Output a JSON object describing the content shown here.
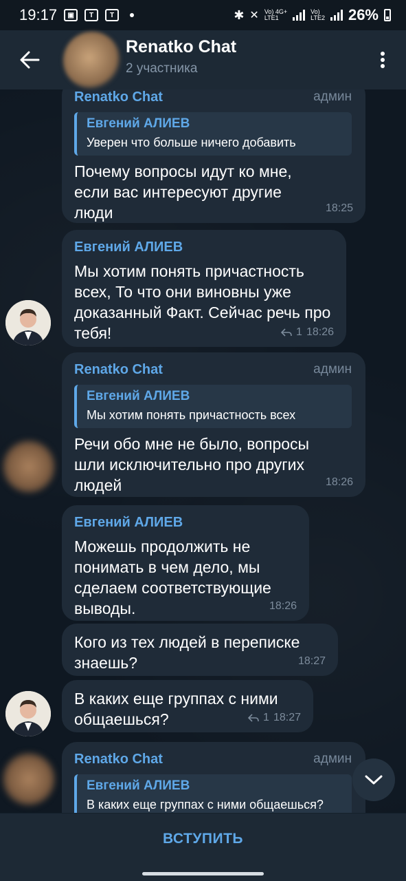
{
  "status_bar": {
    "time": "19:17",
    "network_1": "Vo) 4G+\nLTE1",
    "network_2": "Vo)\nLTE2",
    "battery": "26%"
  },
  "header": {
    "title": "Renatko Chat",
    "subtitle": "2 участника"
  },
  "messages": [
    {
      "sender": "Renatko Chat",
      "role": "админ",
      "reply_name": "Евгений АЛИЕВ",
      "reply_text": "Уверен что больше ничего добавить",
      "text": "Почему вопросы идут ко мне, если вас интересуют другие люди",
      "time": "18:25"
    },
    {
      "sender": "Евгений АЛИЕВ",
      "text": "Мы хотим понять причастность всех, То что они виновны уже доказанный Факт. Сейчас речь про тебя!",
      "replies": "1",
      "time": "18:26"
    },
    {
      "sender": "Renatko Chat",
      "role": "админ",
      "reply_name": "Евгений АЛИЕВ",
      "reply_text": "Мы хотим понять причастность всех",
      "text": "Речи обо мне не было, вопросы шли исключительно про других людей",
      "time": "18:26"
    },
    {
      "sender": "Евгений АЛИЕВ",
      "text": "Можешь продолжить не понимать в чем дело, мы сделаем соответствующие выводы.",
      "time": "18:26"
    },
    {
      "text": "Кого из тех людей в переписке знаешь?",
      "time": "18:27"
    },
    {
      "text": "В каких еще группах с ними общаешься?",
      "replies": "1",
      "time": "18:27"
    },
    {
      "sender": "Renatko Chat",
      "role": "админ",
      "reply_name": "Евгений АЛИЕВ",
      "reply_text": "В каких еще группах с ними общаешься?"
    }
  ],
  "join_button": "ВСТУПИТЬ",
  "icons": {
    "back": "arrow-left-icon",
    "menu": "more-vertical-icon",
    "scroll_down": "chevron-down-icon",
    "reply_count": "reply-arrow-icon"
  },
  "colors": {
    "accent": "#5fa8e8",
    "bubble": "#1f2b38",
    "header": "#1d2935",
    "background": "#0f1822"
  }
}
